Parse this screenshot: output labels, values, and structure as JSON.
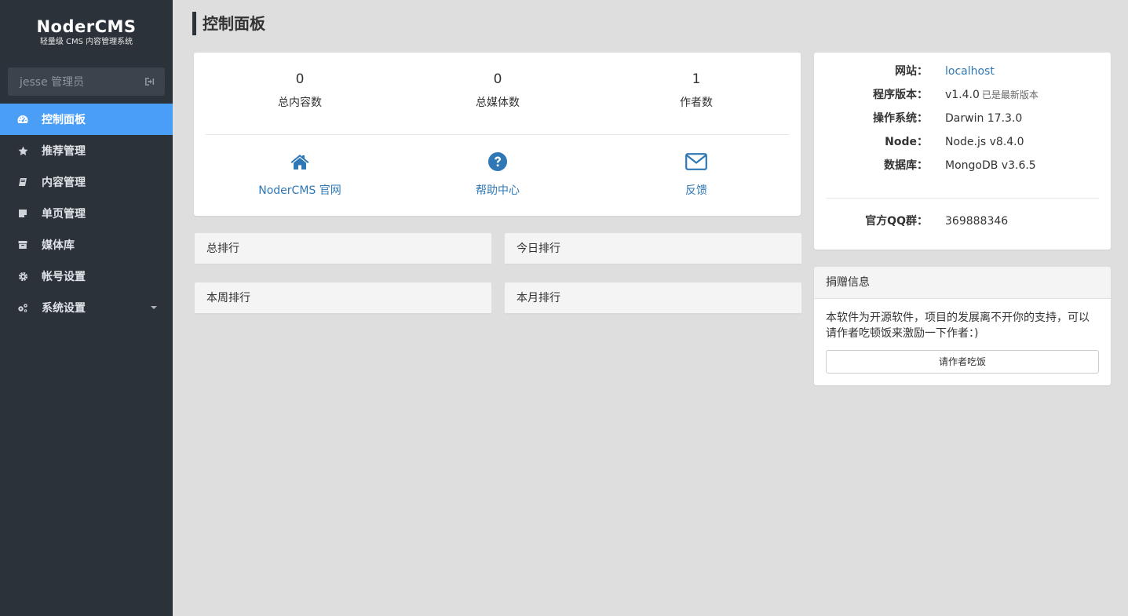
{
  "brand": {
    "title": "NoderCMS",
    "subtitle": "轻量级 CMS 内容管理系统"
  },
  "user": {
    "label": "jesse 管理员"
  },
  "sidebar": {
    "items": [
      {
        "label": "控制面板",
        "icon": "dashboard-icon"
      },
      {
        "label": "推荐管理",
        "icon": "star-icon"
      },
      {
        "label": "内容管理",
        "icon": "book-icon"
      },
      {
        "label": "单页管理",
        "icon": "sticky-note-icon"
      },
      {
        "label": "媒体库",
        "icon": "archive-icon"
      },
      {
        "label": "帐号设置",
        "icon": "gear-icon"
      },
      {
        "label": "系统设置",
        "icon": "gears-icon"
      }
    ],
    "active_index": 0
  },
  "page": {
    "title": "控制面板"
  },
  "stats": [
    {
      "value": "0",
      "label": "总内容数"
    },
    {
      "value": "0",
      "label": "总媒体数"
    },
    {
      "value": "1",
      "label": "作者数"
    }
  ],
  "links": [
    {
      "label": "NoderCMS 官网",
      "icon": "home-icon"
    },
    {
      "label": "帮助中心",
      "icon": "question-circle-icon"
    },
    {
      "label": "反馈",
      "icon": "envelope-icon"
    }
  ],
  "rankings": {
    "total": "总排行",
    "today": "今日排行",
    "week": "本周排行",
    "month": "本月排行"
  },
  "info": {
    "site_key": "网站：",
    "site_val": "localhost",
    "version_key": "程序版本：",
    "version_val": "v1.4.0",
    "version_note": "已是最新版本",
    "os_key": "操作系统：",
    "os_val": "Darwin 17.3.0",
    "node_key": "Node：",
    "node_val": "Node.js v8.4.0",
    "db_key": "数据库：",
    "db_val": "MongoDB v3.6.5",
    "qq_key": "官方QQ群：",
    "qq_val": "369888346"
  },
  "donate": {
    "title": "捐赠信息",
    "text": "本软件为开源软件，项目的发展离不开你的支持，可以请作者吃顿饭来激励一下作者：)",
    "button": "请作者吃饭"
  },
  "colors": {
    "sidebar_bg": "#2c323a",
    "accent": "#4a9ef6",
    "link": "#2f78b5",
    "page_bg": "#dedede"
  }
}
